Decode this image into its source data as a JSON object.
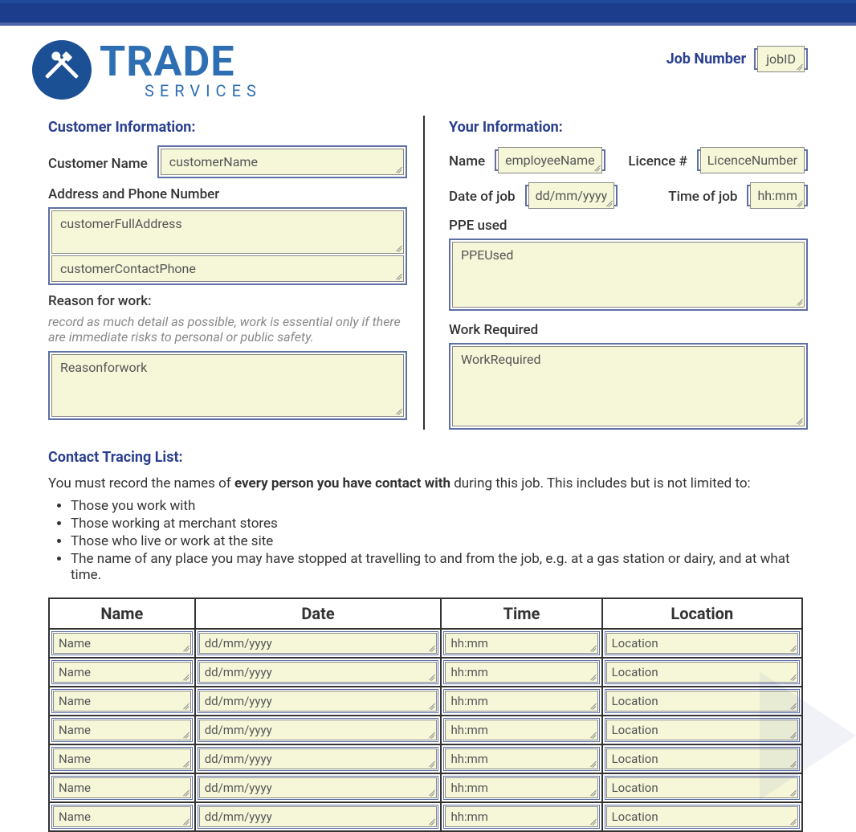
{
  "header": {
    "brand_main": "TRADE",
    "brand_sub": "SERVICES",
    "job_number_label": "Job Number",
    "job_number_placeholder": "jobID"
  },
  "customer": {
    "section_title": "Customer Information:",
    "name_label": "Customer Name",
    "name_placeholder": "customerName",
    "addr_label": "Address and Phone Number",
    "address_placeholder": "customerFullAddress",
    "phone_placeholder": "customerContactPhone",
    "reason_label": "Reason for work:",
    "reason_hint": "record as much detail as possible, work is essential only if there are immediate risks to personal or public safety.",
    "reason_placeholder": "Reasonforwork"
  },
  "yourinfo": {
    "section_title": "Your Information:",
    "name_label": "Name",
    "name_placeholder": "employeeName",
    "licence_label": "Licence #",
    "licence_placeholder": "LicenceNumber",
    "date_label": "Date of job",
    "date_placeholder": "dd/mm/yyyy",
    "time_label": "Time of job",
    "time_placeholder": "hh:mm",
    "ppe_label": "PPE used",
    "ppe_placeholder": "PPEUsed",
    "work_label": "Work Required",
    "work_placeholder": "WorkRequired"
  },
  "tracing": {
    "title": "Contact Tracing List:",
    "intro_pre": "You must record the names of ",
    "intro_strong": "every person you have contact with",
    "intro_post": " during this job. This includes but is not limited to:",
    "bullets": [
      "Those you work with",
      "Those working at merchant stores",
      "Those who live or work at the site",
      "The name of any place you may have stopped at travelling to and from the job, e.g. at a gas station or dairy, and at what time."
    ],
    "cols": {
      "name": "Name",
      "date": "Date",
      "time": "Time",
      "location": "Location"
    },
    "placeholders": {
      "name": "Name",
      "date": "dd/mm/yyyy",
      "time": "hh:mm",
      "location": "Location"
    },
    "row_count": 7
  }
}
